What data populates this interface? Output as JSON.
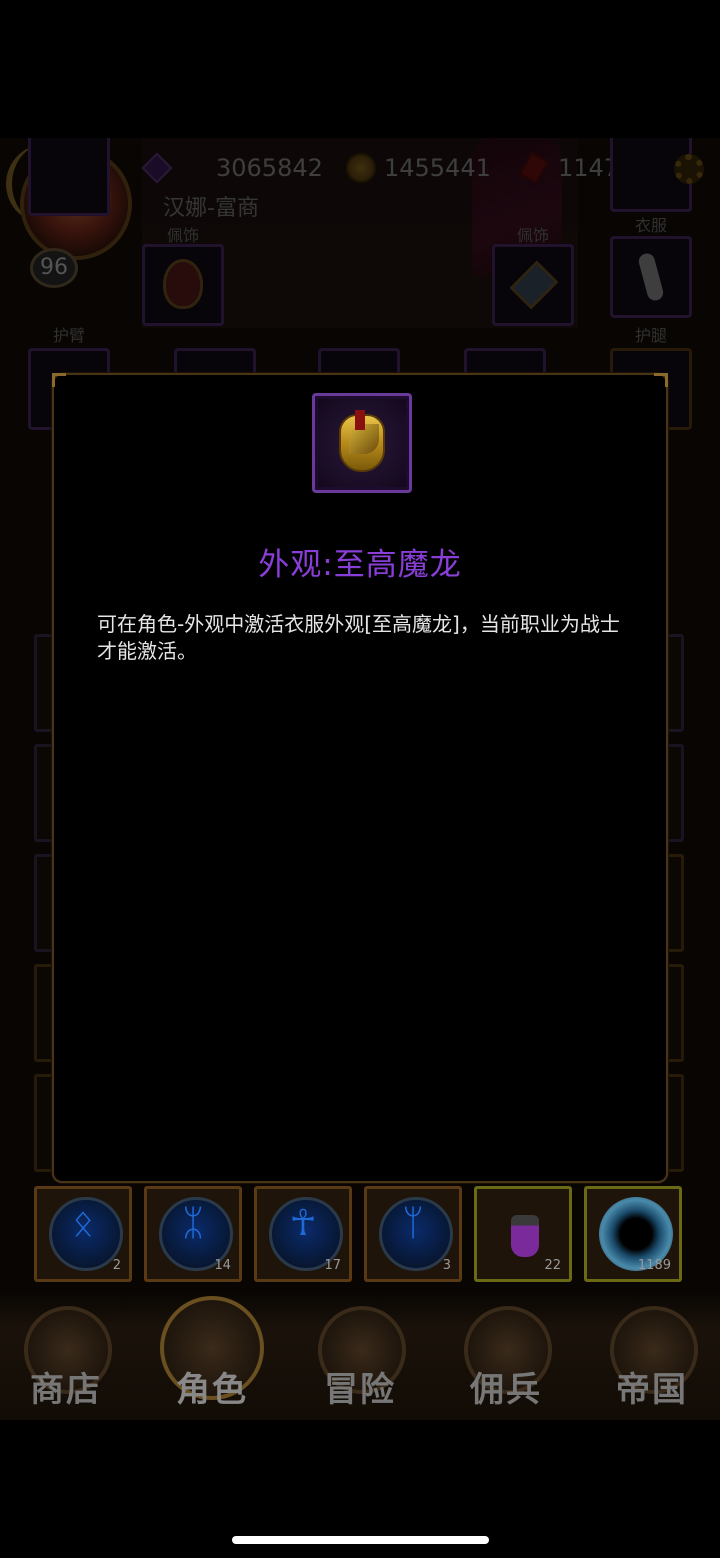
{
  "header": {
    "level": "96",
    "player_name": "汉娜-富商",
    "currencies": [
      {
        "icon": "gem-icon",
        "value": "3065842"
      },
      {
        "icon": "coin-icon",
        "value": "1455441"
      },
      {
        "icon": "ruby-icon",
        "value": "1147"
      }
    ]
  },
  "equipment_labels": {
    "accessory_left": "佩饰",
    "accessory_right": "佩饰",
    "clothes": "衣服",
    "armguard": "护臂",
    "legguard": "护腿"
  },
  "modal": {
    "item_icon": "golden-dragon-armor-icon",
    "title": "外观:至高魔龙",
    "description": "可在角色-外观中激活衣服外观[至高魔龙]，当前职业为战士才能激活。"
  },
  "skills": [
    {
      "icon": "rune-icon",
      "glyph": "ᛟ",
      "count": "2"
    },
    {
      "icon": "rune-icon",
      "glyph": "ᛯ",
      "count": "14"
    },
    {
      "icon": "ankh-icon",
      "glyph": "☥",
      "count": "17"
    },
    {
      "icon": "rune-icon",
      "glyph": "ᛘ",
      "count": "3"
    },
    {
      "icon": "potion-icon",
      "glyph": "",
      "count": "22"
    },
    {
      "icon": "portal-icon",
      "glyph": "",
      "count": "1189"
    }
  ],
  "nav": [
    {
      "label": "商店",
      "icon": "castle-icon",
      "active": false
    },
    {
      "label": "角色",
      "icon": "helmet-icon",
      "active": true
    },
    {
      "label": "冒险",
      "icon": "crossed-swords-icon",
      "active": false
    },
    {
      "label": "佣兵",
      "icon": "mercenary-card-icon",
      "active": false
    },
    {
      "label": "帝国",
      "icon": "crown-icon",
      "active": false
    }
  ]
}
